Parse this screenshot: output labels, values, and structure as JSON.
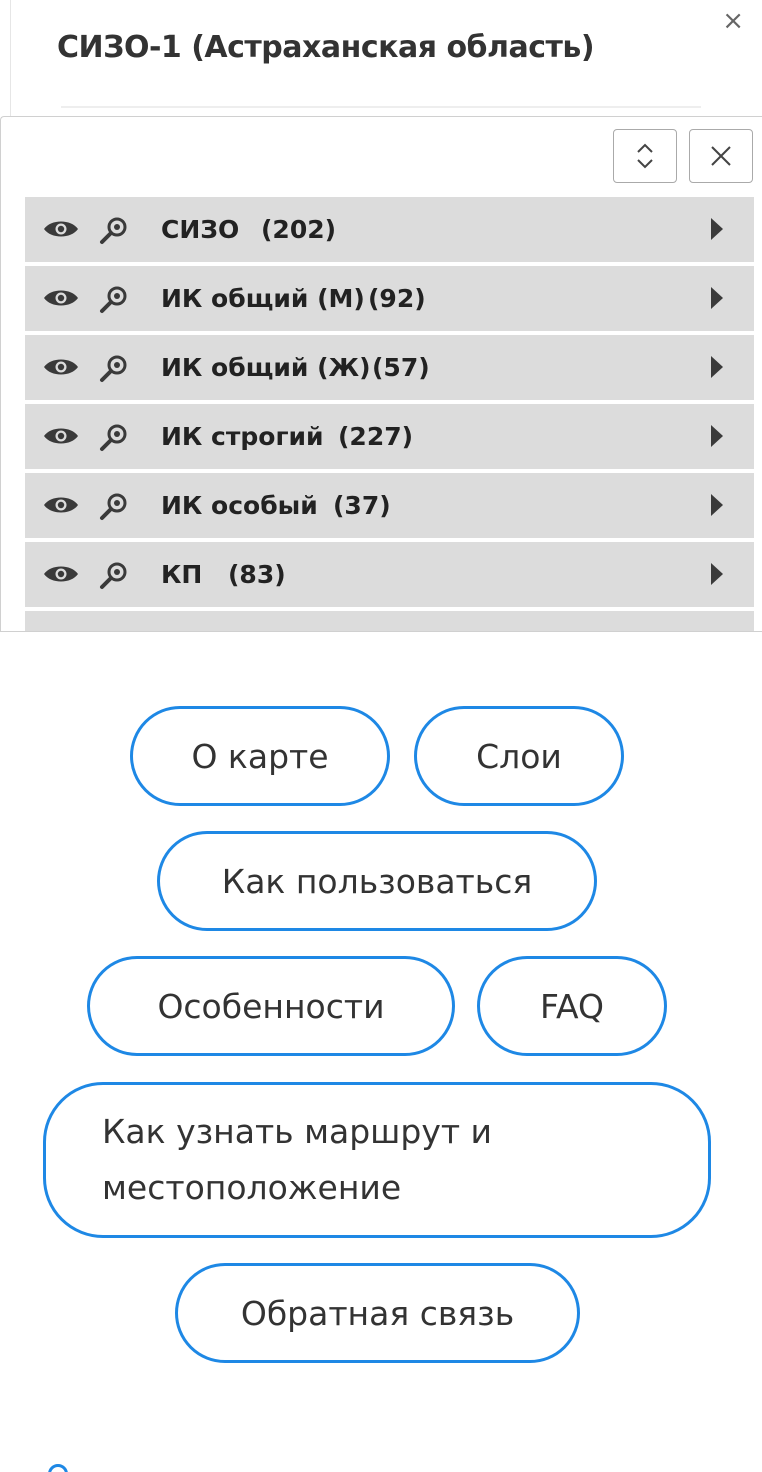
{
  "popup": {
    "title": "СИЗО-1 (Астраханская область)",
    "close_label": "×"
  },
  "layers_panel": {
    "rows": [
      {
        "label": "СИЗО",
        "count": "(202)"
      },
      {
        "label": "ИК общий (М)",
        "count": "(92)"
      },
      {
        "label": "ИК общий (Ж)",
        "count": "(57)"
      },
      {
        "label": "ИК строгий",
        "count": "(227)"
      },
      {
        "label": "ИК особый",
        "count": "(37)"
      },
      {
        "label": "КП",
        "count": "(83)"
      }
    ]
  },
  "menu": {
    "about": "О карте",
    "layers": "Слои",
    "how_to_use": "Как пользоваться",
    "features": "Особенности",
    "faq": "FAQ",
    "route": "Как узнать маршрут и местоположение",
    "feedback": "Обратная связь"
  },
  "colors": {
    "accent": "#1e88e5",
    "row_bg": "#dcdcdc"
  }
}
